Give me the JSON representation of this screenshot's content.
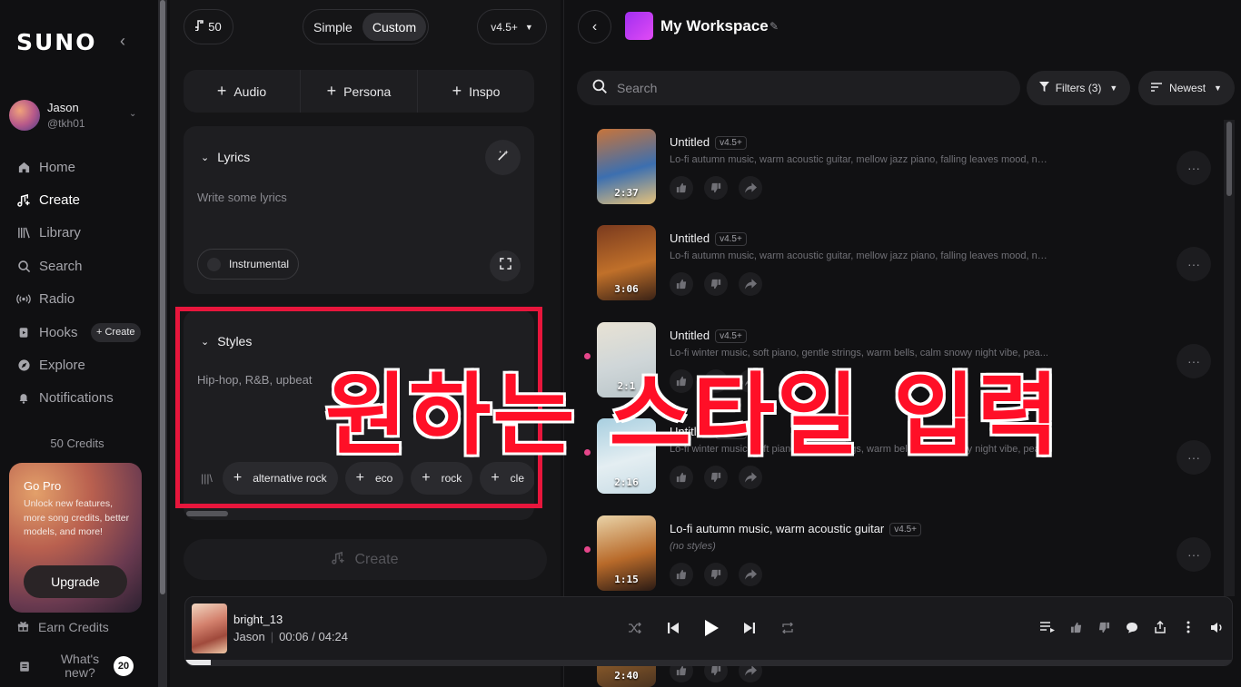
{
  "sidebar": {
    "logo": "SUNO",
    "user": {
      "name": "Jason",
      "handle": "@tkh01"
    },
    "nav": [
      {
        "label": "Home",
        "icon": "home-icon"
      },
      {
        "label": "Create",
        "icon": "create-icon",
        "active": true
      },
      {
        "label": "Library",
        "icon": "library-icon"
      },
      {
        "label": "Search",
        "icon": "search-icon"
      },
      {
        "label": "Radio",
        "icon": "radio-icon"
      },
      {
        "label": "Hooks",
        "icon": "hooks-icon"
      },
      {
        "label": "Explore",
        "icon": "explore-icon"
      },
      {
        "label": "Notifications",
        "icon": "bell-icon"
      }
    ],
    "hooks_create_label": "+ Create",
    "credits": "50 Credits",
    "gopro": {
      "title": "Go Pro",
      "description": "Unlock new features, more song credits, better models, and more!",
      "button": "Upgrade"
    },
    "earn_credits": "Earn Credits",
    "whats_new": "What's new?",
    "whats_new_count": "20"
  },
  "create_panel": {
    "credit_count": "50",
    "mode_simple": "Simple",
    "mode_custom": "Custom",
    "version": "v4.5+",
    "add_buttons": [
      "Audio",
      "Persona",
      "Inspo"
    ],
    "lyrics": {
      "heading": "Lyrics",
      "placeholder": "Write some lyrics",
      "instrumental_label": "Instrumental"
    },
    "styles": {
      "heading": "Styles",
      "placeholder": "Hip-hop, R&B, upbeat",
      "chips": [
        "alternative rock",
        "eco",
        "rock",
        "cle"
      ]
    },
    "create_button": "Create"
  },
  "workspace": {
    "title": "My Workspace",
    "search_placeholder": "Search",
    "filters_label": "Filters (3)",
    "sort_label": "Newest",
    "songs": [
      {
        "title": "Untitled",
        "version": "v4.5+",
        "style": "Lo-fi autumn music, warm acoustic guitar, mellow jazz piano, falling leaves mood, no...",
        "duration": "2:37",
        "dot": false,
        "art": [
          "#c8743a",
          "#3c6fb0",
          "#e6c27a"
        ]
      },
      {
        "title": "Untitled",
        "version": "v4.5+",
        "style": "Lo-fi autumn music, warm acoustic guitar, mellow jazz piano, falling leaves mood, no...",
        "duration": "3:06",
        "dot": false,
        "art": [
          "#7a3a1e",
          "#c0702a",
          "#3a2216"
        ]
      },
      {
        "title": "Untitled",
        "version": "v4.5+",
        "style": "Lo-fi winter music, soft piano, gentle strings, warm bells, calm snowy night vibe, pea...",
        "duration": "2:1",
        "dot": true,
        "art": [
          "#e8e2d4",
          "#cfd6d8",
          "#b8c4c8"
        ]
      },
      {
        "title": "Untitled",
        "version": "v4.5+",
        "style": "Lo-fi winter music, soft piano, gentle strings, warm bells, calm snowy night vibe, pea...",
        "duration": "2:16",
        "dot": true,
        "art": [
          "#a8cfe0",
          "#e4eef2",
          "#c9dde6"
        ]
      },
      {
        "title": "Lo-fi autumn music, warm acoustic guitar",
        "version": "v4.5+",
        "style": "(no styles)",
        "duration": "1:15",
        "dot": true,
        "art": [
          "#e9d3a8",
          "#b86a2a",
          "#2a1a14"
        ]
      },
      {
        "title": "",
        "version": "",
        "style": "",
        "duration": "2:40",
        "dot": false,
        "art": [
          "#c9a46a",
          "#8a5a2a",
          "#4a3320"
        ]
      }
    ]
  },
  "overlay_text": "원하는 스타일 입력",
  "player": {
    "title": "bright_13",
    "artist": "Jason",
    "current_time": "00:06",
    "total_time": "04:24",
    "progress": 0.024
  }
}
